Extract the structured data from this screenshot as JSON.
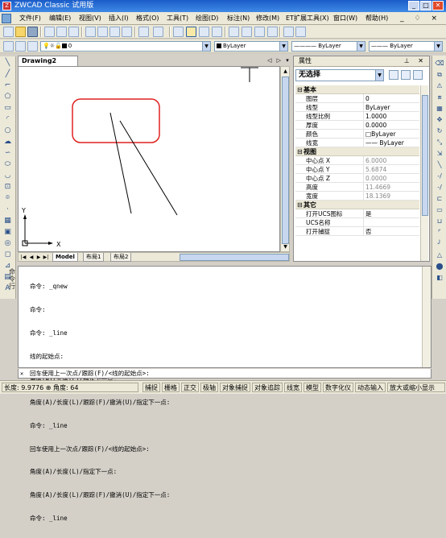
{
  "window": {
    "title": "ZWCAD Classic 试用版",
    "min": "_",
    "max": "□",
    "close": "✕"
  },
  "menu": [
    "文件(F)",
    "编辑(E)",
    "视图(V)",
    "插入(I)",
    "格式(O)",
    "工具(T)",
    "绘图(D)",
    "标注(N)",
    "修改(M)",
    "ET扩展工具(X)",
    "窗口(W)",
    "帮助(H)"
  ],
  "mdi_controls": "_ ♢ ×",
  "toolbar2": {
    "layer_value": "0",
    "color_value": "ByLayer",
    "linetype_value": "ByLayer",
    "lineweight_value": "ByLayer"
  },
  "drawing": {
    "tab_label": "Drawing2",
    "controls": "◁ ▷ ▾ ✕",
    "ucs_y": "Y",
    "ucs_x": "X"
  },
  "layout_tabs": [
    "Model",
    "布局1",
    "布局2"
  ],
  "properties": {
    "title": "属性",
    "header_btns": "⊥ ✕",
    "selection": "无选择",
    "categories": [
      {
        "name": "基本",
        "rows": [
          {
            "key": "图层",
            "value": "0"
          },
          {
            "key": "线型",
            "value": "ByLayer"
          },
          {
            "key": "线型比例",
            "value": "1.0000"
          },
          {
            "key": "厚度",
            "value": "0.0000"
          },
          {
            "key": "颜色",
            "value": "□ByLayer"
          },
          {
            "key": "线宽",
            "value": "—— ByLayer"
          }
        ]
      },
      {
        "name": "视图",
        "rows": [
          {
            "key": "中心点 X",
            "value": "6.0000"
          },
          {
            "key": "中心点 Y",
            "value": "5.6874"
          },
          {
            "key": "中心点 Z",
            "value": "0.0000"
          },
          {
            "key": "高度",
            "value": "11.4669"
          },
          {
            "key": "宽度",
            "value": "18.1369"
          }
        ]
      },
      {
        "name": "其它",
        "rows": [
          {
            "key": "打开UCS图标",
            "value": "是"
          },
          {
            "key": "UCS名称",
            "value": ""
          },
          {
            "key": "打开捕捉",
            "value": "否"
          }
        ]
      }
    ]
  },
  "command": {
    "label": "命令行",
    "history": [
      "命令: _qnew",
      "命令:",
      "命令: _line",
      "线的起始点:",
      "角度(A)/长度(L)/指定下一点:",
      "角度(A)/长度(L)/跟踪(F)/撤消(U)/指定下一点:",
      "命令: _line",
      "回车使用上一次点/跟踪(F)/<线的起始点>:",
      "角度(A)/长度(L)/指定下一点:",
      "角度(A)/长度(L)/跟踪(F)/撤消(U)/指定下一点:",
      "命令: _line"
    ],
    "prompt": "回车使用上一次点/跟踪(F)/<线的起始点>:"
  },
  "status": {
    "coords": "长度: 9.9776 ⊕ 角度: 64",
    "buttons": [
      "捕捉",
      "栅格",
      "正交",
      "极轴",
      "对象捕捉",
      "对象追踪",
      "线宽",
      "模型",
      "数字化仪",
      "动态输入",
      "放大或缩小显示"
    ]
  }
}
